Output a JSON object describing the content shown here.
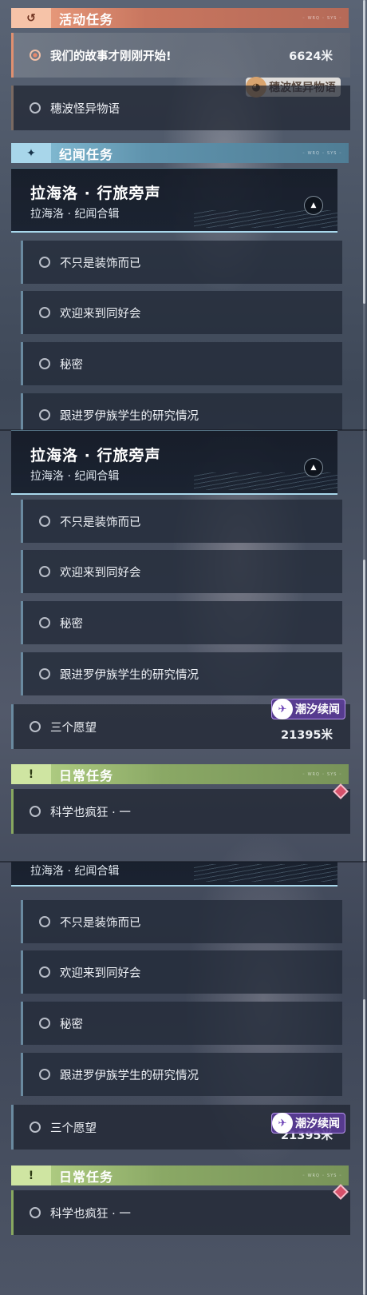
{
  "sections": {
    "event": {
      "title": "活动任务",
      "chip_icon": "↺",
      "deco": "◦ WRQ ◦ SYS ◦"
    },
    "story": {
      "title": "纪闻任务",
      "chip_icon": "✦",
      "deco": "◦ WRQ ◦ SYS ◦"
    },
    "daily": {
      "title": "日常任务",
      "chip_icon": "!",
      "deco": "◦ WRQ ◦ SYS ◦"
    }
  },
  "event_quests": [
    {
      "label": "我们的故事才刚刚开始!",
      "distance": "6624米",
      "active": true
    },
    {
      "label": "穗波怪异物语"
    }
  ],
  "event_badge": "穗波怪异物语",
  "story_group": {
    "title": "拉海洛 · 行旅旁声",
    "subtitle": "拉海洛 · 纪闻合辑",
    "toggle": "▲"
  },
  "story_sub_quests": [
    "不只是装饰而已",
    "欢迎来到同好会",
    "秘密",
    "跟进罗伊族学生的研究情况"
  ],
  "story_quest": {
    "label": "三个愿望",
    "distance": "21395米"
  },
  "tide_badge": "潮汐续闻",
  "daily_quest": {
    "label": "科学也疯狂 · 一"
  },
  "colors": {
    "event_accent": "#f2a584",
    "story_accent": "#8cc6dd",
    "daily_accent": "#b9d68a"
  }
}
